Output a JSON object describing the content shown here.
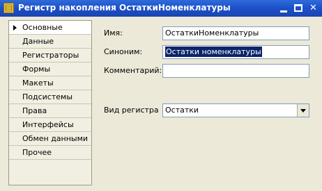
{
  "window": {
    "title": "Регистр накопления ОстаткиНоменклатуры",
    "controls": {
      "minimize": "minimize",
      "maximize": "maximize",
      "close": "✕"
    }
  },
  "sidebar": {
    "items": [
      {
        "label": "Основные",
        "active": true
      },
      {
        "label": "Данные"
      },
      {
        "label": "Регистраторы"
      },
      {
        "label": "Формы"
      },
      {
        "label": "Макеты"
      },
      {
        "label": "Подсистемы"
      },
      {
        "label": "Права"
      },
      {
        "label": "Интерфейсы"
      },
      {
        "label": "Обмен данными"
      },
      {
        "label": "Прочее"
      }
    ]
  },
  "form": {
    "name_label": "Имя:",
    "name_value": "ОстаткиНоменклатуры",
    "synonym_label": "Синоним:",
    "synonym_value": "Остатки номенклатуры",
    "comment_label": "Комментарий:",
    "comment_value": "",
    "register_type_label": "Вид регистра",
    "register_type_value": "Остатки"
  }
}
